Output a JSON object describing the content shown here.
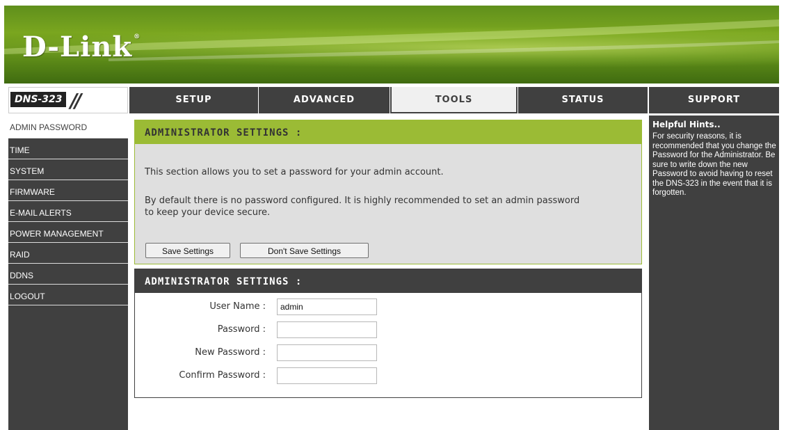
{
  "brand": {
    "logo": "D-Link",
    "registered_mark": "®",
    "model": "DNS-323"
  },
  "nav": {
    "tabs": [
      {
        "label": "SETUP",
        "active": false
      },
      {
        "label": "ADVANCED",
        "active": false
      },
      {
        "label": "TOOLS",
        "active": true
      },
      {
        "label": "STATUS",
        "active": false
      }
    ],
    "support": "SUPPORT"
  },
  "sidebar": {
    "items": [
      {
        "label": "ADMIN PASSWORD",
        "active": true
      },
      {
        "label": "TIME",
        "active": false
      },
      {
        "label": "SYSTEM",
        "active": false
      },
      {
        "label": "FIRMWARE",
        "active": false
      },
      {
        "label": "E-MAIL ALERTS",
        "active": false
      },
      {
        "label": "POWER MANAGEMENT",
        "active": false
      },
      {
        "label": "RAID",
        "active": false
      },
      {
        "label": "DDNS",
        "active": false
      },
      {
        "label": "LOGOUT",
        "active": false
      }
    ]
  },
  "settings_box": {
    "title": "ADMINISTRATOR SETTINGS :",
    "para1": "This section allows you to set a password for your admin account.",
    "para2_line1": "By default there is no password configured. It is highly recommended to set an admin password",
    "para2_line2": "to keep your device secure.",
    "save_label": "Save Settings",
    "dont_save_label": "Don't Save Settings"
  },
  "form_box": {
    "title": "ADMINISTRATOR SETTINGS :",
    "fields": [
      {
        "label": "User Name :",
        "value": "admin"
      },
      {
        "label": "Password :",
        "value": ""
      },
      {
        "label": "New Password :",
        "value": ""
      },
      {
        "label": "Confirm Password :",
        "value": ""
      }
    ]
  },
  "hints": {
    "title": "Helpful Hints..",
    "text": "For security reasons, it is recommended that you change the Password for the Administrator. Be sure to write down the new Password to avoid having to reset the DNS-323 in the event that it is forgotten."
  },
  "colors": {
    "header_green": "#7aa61f",
    "nav_dark": "#404040",
    "accent_green": "#9bbb35",
    "panel_gray": "#dfdfdf"
  }
}
